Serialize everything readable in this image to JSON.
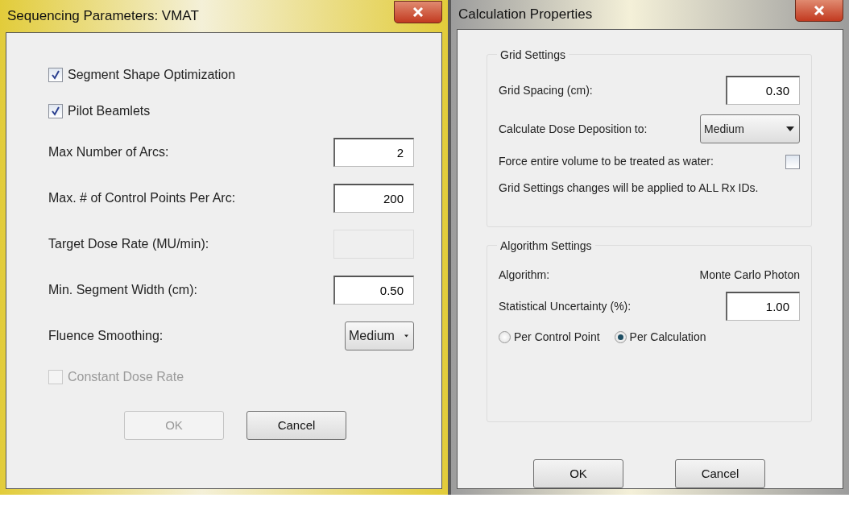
{
  "dialogs": [
    {
      "title": "Sequencing Parameters: VMAT",
      "color": "#e2cc3a",
      "rows": [
        {
          "kind": "checkbox",
          "label": "Segment Shape Optimization",
          "checked": true,
          "disabled": false
        },
        {
          "kind": "checkbox",
          "label": "Pilot Beamlets",
          "checked": true,
          "disabled": false
        },
        {
          "kind": "field",
          "label": "Max Number of Arcs:",
          "value": "2",
          "disabled": false
        },
        {
          "kind": "field",
          "label": "Max. # of Control Points Per Arc:",
          "value": "200",
          "disabled": false
        },
        {
          "kind": "field",
          "label": "Target Dose Rate (MU/min):",
          "disabled": true
        },
        {
          "kind": "field",
          "label": "Min. Segment Width (cm):",
          "value": "0.50",
          "disabled": false
        },
        {
          "kind": "select",
          "label": "Fluence Smoothing:",
          "value": "Medium"
        },
        {
          "kind": "checkbox",
          "label": "Constant Dose Rate",
          "checked": false,
          "disabled": true
        }
      ],
      "buttons": [
        {
          "label": "OK",
          "disabled": true
        },
        {
          "label": "Cancel",
          "disabled": false
        }
      ]
    },
    {
      "title": "Calculation Properties",
      "color": "#9c9c9c",
      "groups": [
        {
          "title": "Grid Settings",
          "rows": [
            {
              "kind": "field",
              "label": "Grid Spacing (cm):",
              "value": "0.30",
              "disabled": false
            },
            {
              "kind": "select",
              "label": "Calculate Dose Deposition to:",
              "value": "Medium"
            },
            {
              "kind": "check_right",
              "label": "Force entire volume to be treated as water:",
              "checked": false,
              "disabled": false
            },
            {
              "kind": "note",
              "label": "Grid Settings changes will be applied to ALL Rx IDs."
            }
          ]
        },
        {
          "title": "Algorithm Settings",
          "rows": [
            {
              "kind": "info",
              "label": "Algorithm:",
              "value": "Monte Carlo Photon"
            },
            {
              "kind": "field",
              "label": "Statistical Uncertainty (%):",
              "value": "1.00",
              "disabled": false
            },
            {
              "kind": "radios",
              "options": [
                {
                  "label": "Per Control Point",
                  "selected": false
                },
                {
                  "label": "Per Calculation",
                  "selected": true
                }
              ]
            }
          ]
        }
      ],
      "buttons": [
        {
          "label": "OK",
          "disabled": false
        },
        {
          "label": "Cancel",
          "disabled": false
        }
      ]
    }
  ]
}
